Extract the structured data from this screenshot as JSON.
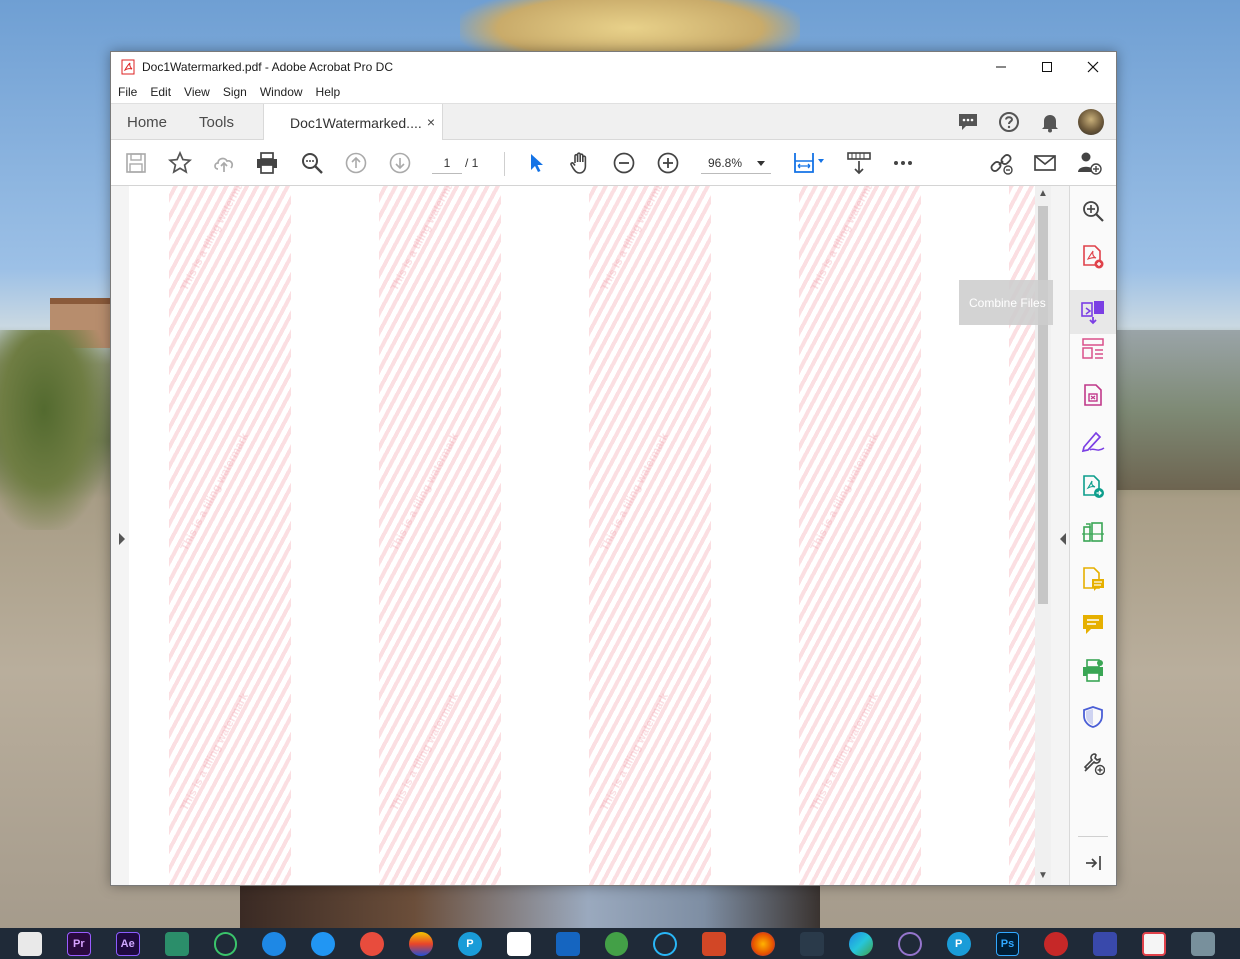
{
  "window": {
    "title": "Doc1Watermarked.pdf - Adobe Acrobat Pro DC"
  },
  "menu": [
    "File",
    "Edit",
    "View",
    "Sign",
    "Window",
    "Help"
  ],
  "tabs": {
    "home": "Home",
    "tools": "Tools",
    "document": "Doc1Watermarked....",
    "close_glyph": "×"
  },
  "toolbar": {
    "current_page": "1",
    "total_pages": "/ 1",
    "zoom": "96.8%"
  },
  "document": {
    "watermark_text": "This is a tiling watermark",
    "watermark_color": "#f4aab2"
  },
  "tooltip": {
    "text": "Combine Files"
  },
  "right_pane_icons": [
    "zoom-tool-icon",
    "create-pdf-icon",
    "combine-files-icon",
    "organize-pages-icon",
    "edit-pdf-icon",
    "fill-sign-icon",
    "export-pdf-icon",
    "scan-icon",
    "send-for-comments-icon",
    "comment-icon",
    "print-production-icon",
    "protect-icon",
    "more-tools-icon",
    "collapse-pane-icon"
  ],
  "colors": {
    "accent": "#1473e6",
    "pdf_red": "#e0424b",
    "purple": "#7b3fe4",
    "green": "#3aa655",
    "yellow": "#e6b000",
    "taskbar": "#1f2a38"
  },
  "taskbar": {
    "icons": [
      "sketchbook-icon",
      "premiere-pro-icon",
      "after-effects-icon",
      "sound-app-icon",
      "sync-app-icon",
      "download-app-icon",
      "update-app-icon",
      "paint-app-icon",
      "color-app-icon",
      "pdf-reader-p-icon",
      "ccna-app-icon",
      "build-app-icon",
      "green-app-icon",
      "quickbooks-icon",
      "powerpoint-icon",
      "firefox-icon",
      "arrow-app-icon",
      "edge-icon",
      "purple-app-icon",
      "pdf-p-app-icon",
      "photoshop-icon",
      "red-app-icon",
      "blue-app-icon",
      "acrobat-icon",
      "cube-app-icon"
    ],
    "labels": {
      "premiere": "Pr",
      "after_effects": "Ae",
      "photoshop": "Ps",
      "p": "P"
    }
  }
}
